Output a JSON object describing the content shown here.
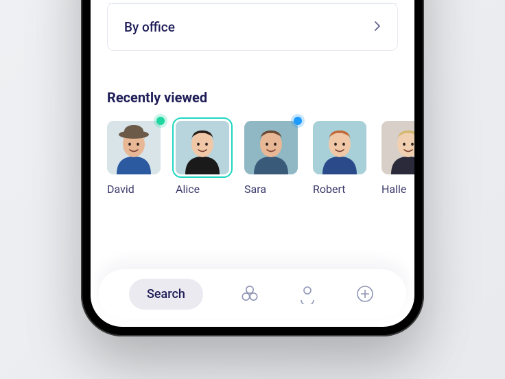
{
  "filterRow": {
    "label": "By office"
  },
  "sectionTitle": "Recently viewed",
  "people": [
    {
      "name": "David",
      "status": "green",
      "selected": false,
      "bg": "#d8e4e8",
      "skin": "#e8b896",
      "hair": "#6b5a47",
      "shirt": "#2c5aa0",
      "hat": true
    },
    {
      "name": "Alice",
      "status": null,
      "selected": true,
      "bg": "#b8d4dc",
      "skin": "#f0c8a8",
      "hair": "#2a1f1a",
      "shirt": "#1a1a1a",
      "hat": false
    },
    {
      "name": "Sara",
      "status": "blue",
      "selected": false,
      "bg": "#8fb8c4",
      "skin": "#e8b896",
      "hair": "#6b4a35",
      "shirt": "#3a5a7a",
      "hat": false
    },
    {
      "name": "Robert",
      "status": null,
      "selected": false,
      "bg": "#a8d0d8",
      "skin": "#f0c8a8",
      "hair": "#c26b3a",
      "shirt": "#2a4a8a",
      "hat": false
    },
    {
      "name": "Halle",
      "status": null,
      "selected": false,
      "bg": "#d8d0c8",
      "skin": "#f0d0b0",
      "hair": "#d4b870",
      "shirt": "#2a2a3a",
      "hat": false
    }
  ],
  "tabbar": {
    "activeLabel": "Search",
    "icons": [
      "groups-icon",
      "profile-icon",
      "add-icon"
    ]
  }
}
